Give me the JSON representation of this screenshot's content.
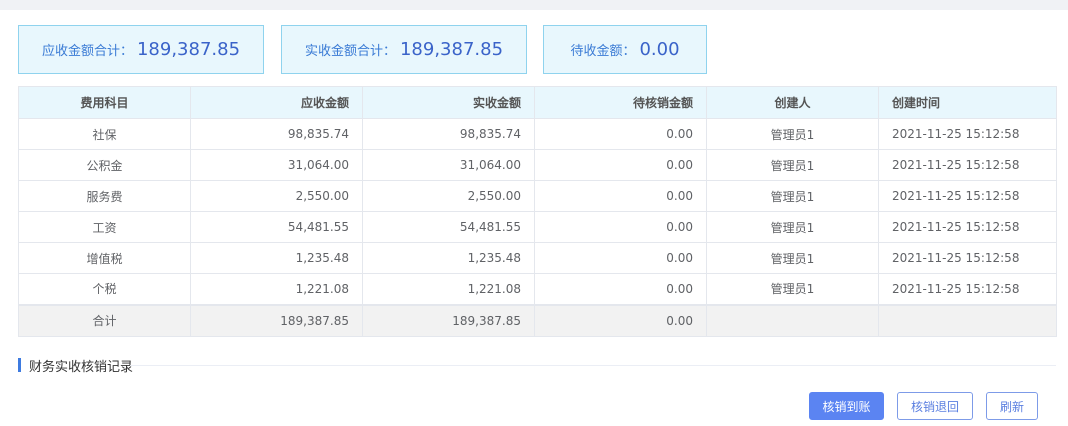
{
  "summary": {
    "receivable_label": "应收金额合计：",
    "receivable_value": "189,387.85",
    "received_label": "实收金额合计：",
    "received_value": "189,387.85",
    "pending_label": "待收金额：",
    "pending_value": "0.00"
  },
  "table": {
    "headers": [
      "费用科目",
      "应收金额",
      "实收金额",
      "待核销金额",
      "创建人",
      "创建时间"
    ],
    "rows": [
      [
        "社保",
        "98,835.74",
        "98,835.74",
        "0.00",
        "管理员1",
        "2021-11-25 15:12:58"
      ],
      [
        "公积金",
        "31,064.00",
        "31,064.00",
        "0.00",
        "管理员1",
        "2021-11-25 15:12:58"
      ],
      [
        "服务费",
        "2,550.00",
        "2,550.00",
        "0.00",
        "管理员1",
        "2021-11-25 15:12:58"
      ],
      [
        "工资",
        "54,481.55",
        "54,481.55",
        "0.00",
        "管理员1",
        "2021-11-25 15:12:58"
      ],
      [
        "增值税",
        "1,235.48",
        "1,235.48",
        "0.00",
        "管理员1",
        "2021-11-25 15:12:58"
      ],
      [
        "个税",
        "1,221.08",
        "1,221.08",
        "0.00",
        "管理员1",
        "2021-11-25 15:12:58"
      ]
    ],
    "footer": [
      "合计",
      "189,387.85",
      "189,387.85",
      "0.00",
      "",
      ""
    ]
  },
  "section": {
    "title": "财务实收核销记录"
  },
  "actions": {
    "confirm_label": "核销到账",
    "revert_label": "核销退回",
    "refresh_label": "刷新"
  }
}
